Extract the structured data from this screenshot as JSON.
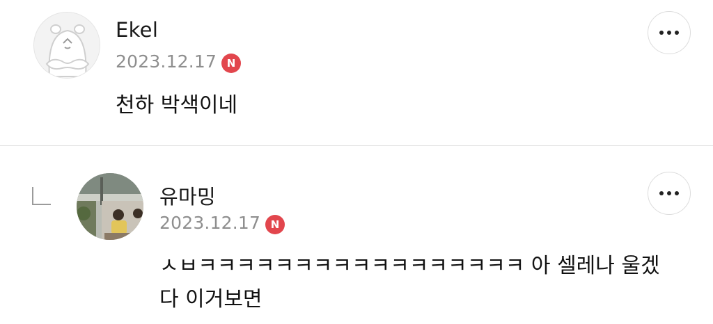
{
  "comments": [
    {
      "author": "Ekel",
      "date": "2023.12.17",
      "badge": "N",
      "text": "천하 박색이네",
      "avatar_icon": "hamster-avatar-icon",
      "more_icon": "more-horizontal-icon"
    },
    {
      "author": "유마밍",
      "date": "2023.12.17",
      "badge": "N",
      "text": "ㅅㅂㅋㅋㅋㅋㅋㅋㅋㅋㅋㅋㅋㅋㅋㅋㅋㅋㅋ 아 셀레나 울겠다 이거보면",
      "is_reply": true,
      "avatar_icon": "photo-avatar",
      "more_icon": "more-horizontal-icon"
    }
  ],
  "colors": {
    "badge": "#e2464d",
    "date": "#8e8e8e",
    "divider": "#e3e3e3"
  }
}
